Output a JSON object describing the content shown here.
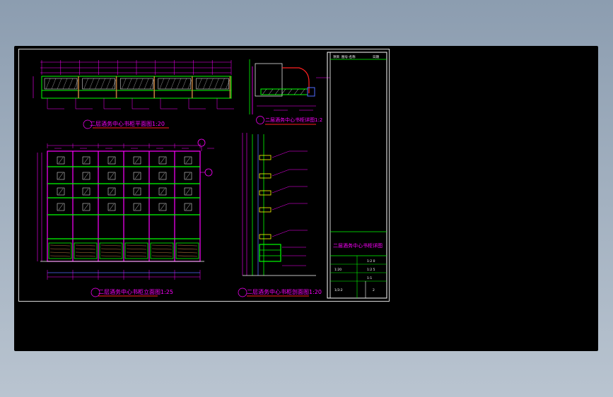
{
  "colors": {
    "background": "#000000",
    "frame": "#d8d8d8",
    "magenta": "#ff00ff",
    "green": "#00ff00",
    "blue": "#4f6bff",
    "yellow": "#ffff00",
    "red": "#ff2020",
    "cyan": "#33ccff",
    "brown": "#b87a3a",
    "white": "#ffffff"
  },
  "views": {
    "plan_caption": "二层酒务中心书柜平面图1:20",
    "elevation_caption": "二层酒务中心书柜立面图1:25",
    "section_caption": "二层酒务中心书柜剖面图1:20",
    "detail_caption": "二层酒务中心书柜详图1:2"
  },
  "title_block": {
    "drawing_title": "二层酒务中心书柜详图",
    "rows": [
      {
        "left": "",
        "right": "1:2 0"
      },
      {
        "left": "1:20",
        "right": "1:2 5"
      },
      {
        "left": "",
        "right": "1:1"
      },
      {
        "left": "1/3:2",
        "right": "2"
      }
    ],
    "header": [
      "项目",
      "图号-名称",
      "日期"
    ]
  }
}
